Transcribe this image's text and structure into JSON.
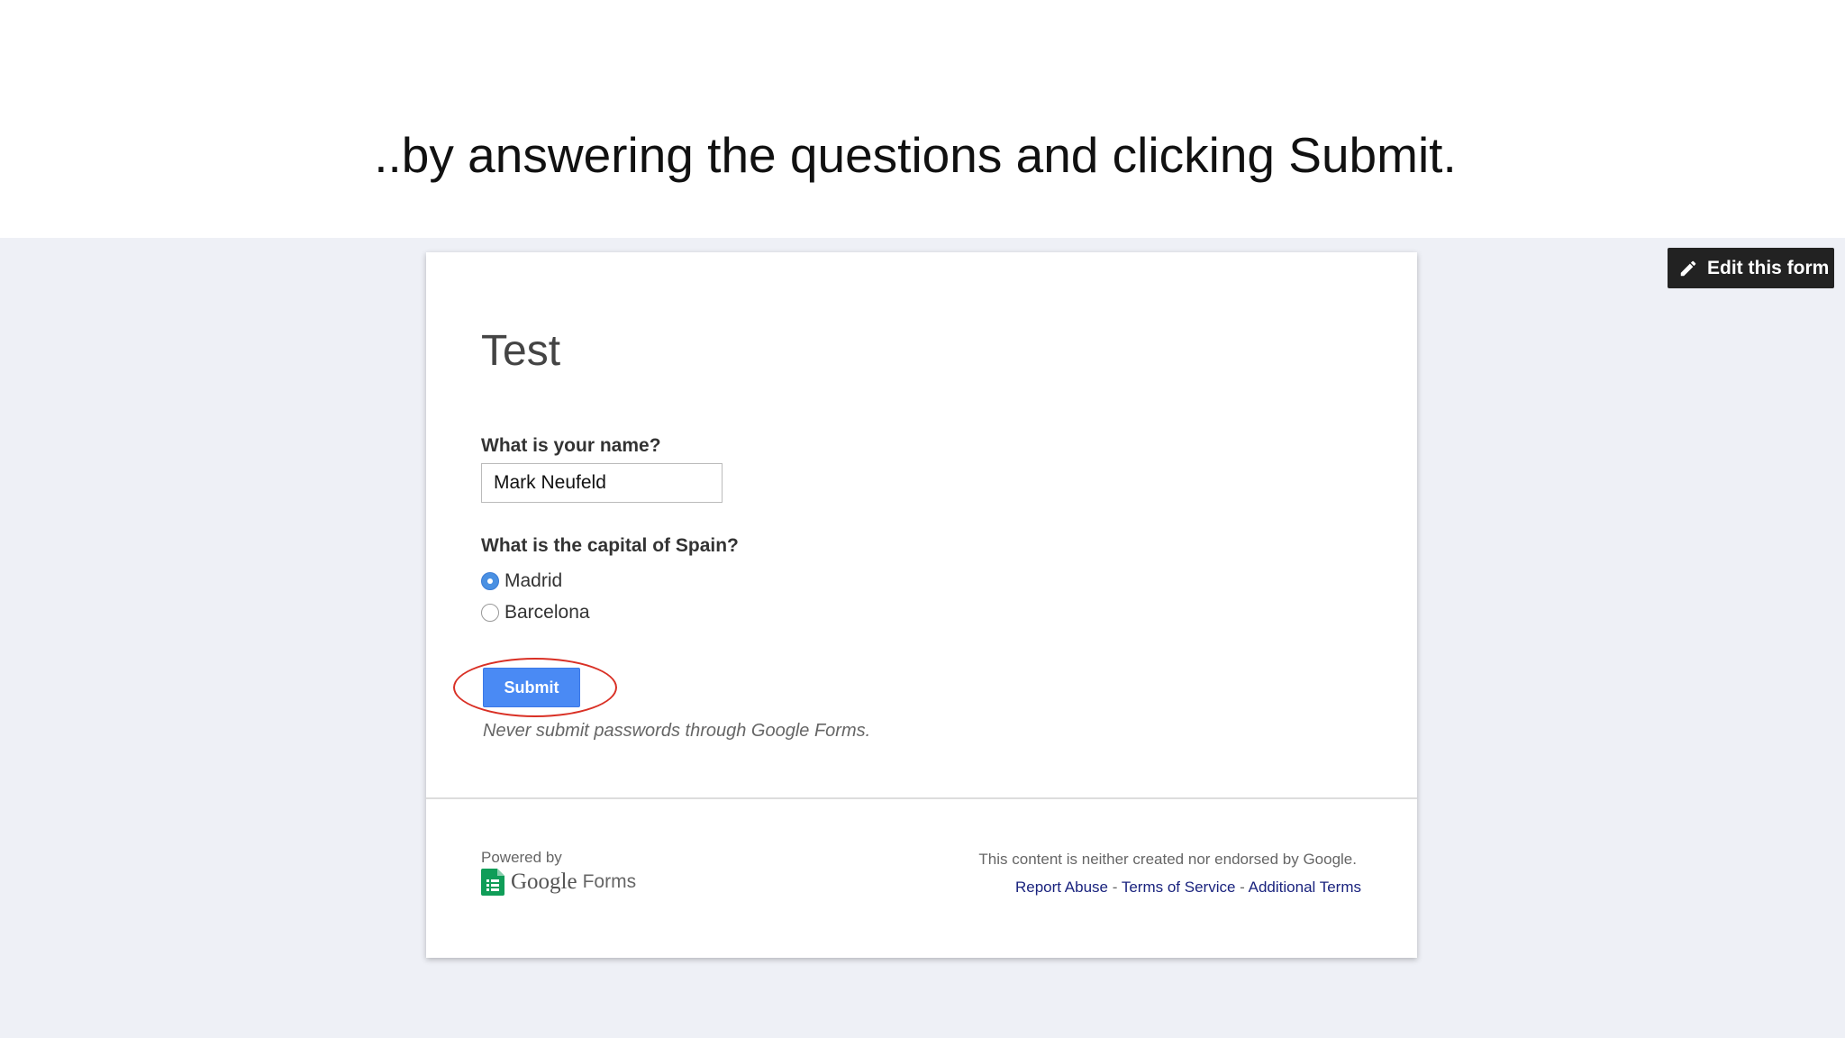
{
  "caption": "..by answering the questions and clicking Submit.",
  "edit_button": {
    "label": "Edit this form",
    "icon": "pencil-icon"
  },
  "form": {
    "title": "Test",
    "questions": [
      {
        "label": "What is your name?",
        "type": "text",
        "value": "Mark Neufeld"
      },
      {
        "label": "What is the capital of Spain?",
        "type": "radio",
        "options": [
          {
            "label": "Madrid",
            "selected": true
          },
          {
            "label": "Barcelona",
            "selected": false
          }
        ]
      }
    ],
    "submit_label": "Submit",
    "password_warning": "Never submit passwords through Google Forms."
  },
  "footer": {
    "powered_by": "Powered by",
    "logo_google": "Google",
    "logo_forms": "Forms",
    "disclaimer": "This content is neither created nor endorsed by Google.",
    "links": {
      "report_abuse": "Report Abuse",
      "separator": "-",
      "terms_of_service": "Terms of Service",
      "additional_terms": "Additional Terms"
    }
  },
  "colors": {
    "page_background": "#eef0f6",
    "submit_blue": "#4a8af4",
    "annotation_red": "#d93025",
    "link_navy": "#1a237e",
    "sheets_green": "#0f9d58"
  }
}
